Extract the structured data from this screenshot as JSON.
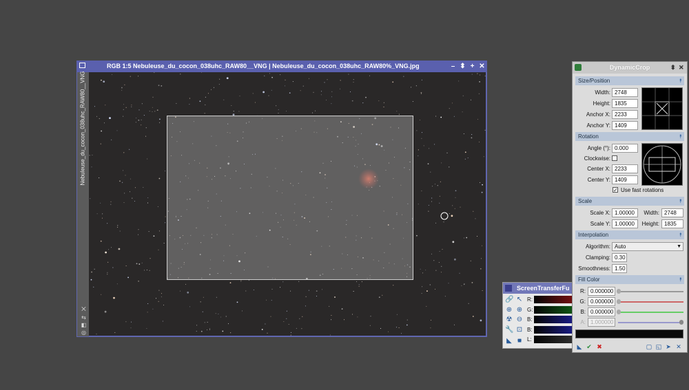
{
  "image_window": {
    "title": "RGB 1:5 Nebuleuse_du_cocon_038uhc_RAW80__VNG | Nebuleuse_du_cocon_038uhc_RAW80%_VNG.jpg",
    "side_tab": "Nebuleuse_du_cocon_038uhc_RAW80__VNG",
    "buttons": [
      "minimize-icon",
      "shade-icon",
      "maximize-icon",
      "close-icon"
    ]
  },
  "stf": {
    "title": "ScreenTransferFu",
    "channels": [
      "R:",
      "G:",
      "B:",
      "B:",
      "L:"
    ],
    "channel_colors": [
      "#7a1010",
      "#0f5a14",
      "#1a1d8a",
      "#1a1d8a",
      "#303030"
    ]
  },
  "dynamic_crop": {
    "title": "DynamicCrop",
    "size_position": {
      "header": "Size/Position",
      "width_label": "Width:",
      "width": "2748",
      "height_label": "Height:",
      "height": "1835",
      "anchor_x_label": "Anchor X:",
      "anchor_x": "2233",
      "anchor_y_label": "Anchor Y:",
      "anchor_y": "1409"
    },
    "rotation": {
      "header": "Rotation",
      "angle_label": "Angle (°):",
      "angle": "0.000",
      "clockwise_label": "Clockwise:",
      "center_x_label": "Center X:",
      "center_x": "2233",
      "center_y_label": "Center Y:",
      "center_y": "1409",
      "fast_label": "Use fast rotations",
      "fast_checked": true
    },
    "scale": {
      "header": "Scale",
      "scale_x_label": "Scale X:",
      "scale_x": "1.00000",
      "scale_y_label": "Scale Y:",
      "scale_y": "1.00000",
      "width_label": "Width:",
      "width": "2748",
      "height_label": "Height:",
      "height": "1835"
    },
    "interpolation": {
      "header": "Interpolation",
      "algorithm_label": "Algorithm:",
      "algorithm": "Auto",
      "clamping_label": "Clamping:",
      "clamping": "0.30",
      "smoothness_label": "Smoothness:",
      "smoothness": "1.50"
    },
    "fill_color": {
      "header": "Fill Color",
      "r_label": "R:",
      "r": "0.000000",
      "g_label": "G:",
      "g": "0.000000",
      "b_label": "B:",
      "b": "0.000000",
      "a_label": "A:",
      "a": "1.000000"
    }
  }
}
